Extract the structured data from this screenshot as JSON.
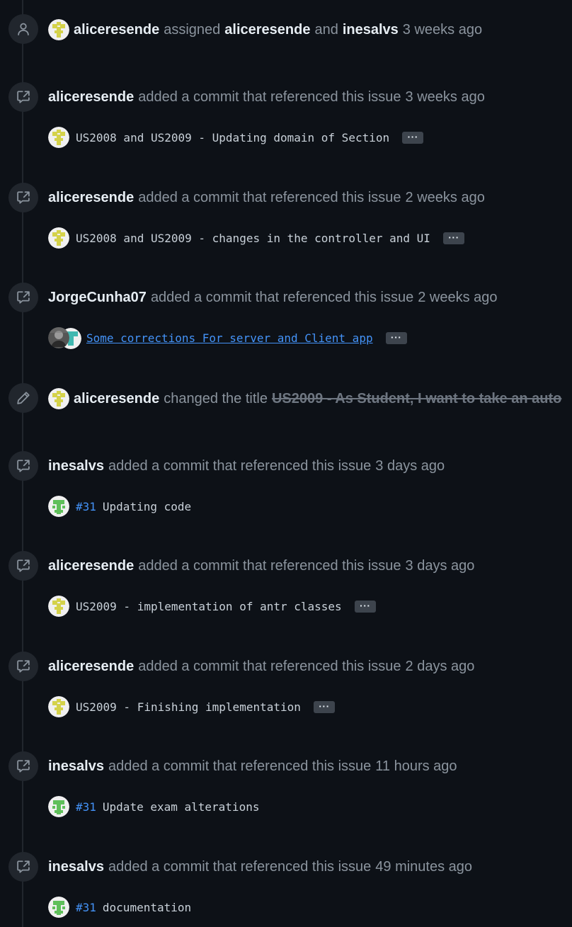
{
  "timeline": {
    "events": [
      {
        "type": "assigned",
        "actor": "aliceresende",
        "verb": "assigned",
        "target1": "aliceresende",
        "conj": "and",
        "target2": "inesalvs",
        "time": "3 weeks ago",
        "icon": "person-icon"
      },
      {
        "type": "commit",
        "actor": "aliceresende",
        "verb": "added a commit that referenced this issue",
        "time": "3 weeks ago",
        "icon": "cross-reference-icon",
        "commit_message": "US2008 and US2009 - Updating domain of Section",
        "ellipsis": "···"
      },
      {
        "type": "commit",
        "actor": "aliceresende",
        "verb": "added a commit that referenced this issue",
        "time": "2 weeks ago",
        "icon": "cross-reference-icon",
        "commit_message": "US2008 and US2009 - changes in the controller and UI",
        "ellipsis": "···"
      },
      {
        "type": "commit",
        "actor": "JorgeCunha07",
        "verb": "added a commit that referenced this issue",
        "time": "2 weeks ago",
        "icon": "cross-reference-icon",
        "commit_message": "Some corrections For server and Client app",
        "ellipsis": "···"
      },
      {
        "type": "renamed",
        "actor": "aliceresende",
        "verb": "changed the title",
        "old_title": "US2009 - As Student, I want to take an auto",
        "icon": "pencil-icon"
      },
      {
        "type": "commit",
        "actor": "inesalvs",
        "verb": "added a commit that referenced this issue",
        "time": "3 days ago",
        "icon": "cross-reference-icon",
        "issue_ref": "#31",
        "commit_message": "Updating code"
      },
      {
        "type": "commit",
        "actor": "aliceresende",
        "verb": "added a commit that referenced this issue",
        "time": "3 days ago",
        "icon": "cross-reference-icon",
        "commit_message": "US2009 - implementation of antr classes",
        "ellipsis": "···"
      },
      {
        "type": "commit",
        "actor": "aliceresende",
        "verb": "added a commit that referenced this issue",
        "time": "2 days ago",
        "icon": "cross-reference-icon",
        "commit_message": "US2009 - Finishing implementation",
        "ellipsis": "···"
      },
      {
        "type": "commit",
        "actor": "inesalvs",
        "verb": "added a commit that referenced this issue",
        "time": "11 hours ago",
        "icon": "cross-reference-icon",
        "issue_ref": "#31",
        "commit_message": "Update exam alterations"
      },
      {
        "type": "commit",
        "actor": "inesalvs",
        "verb": "added a commit that referenced this issue",
        "time": "49 minutes ago",
        "icon": "cross-reference-icon",
        "issue_ref": "#31",
        "commit_message": "documentation"
      }
    ]
  }
}
